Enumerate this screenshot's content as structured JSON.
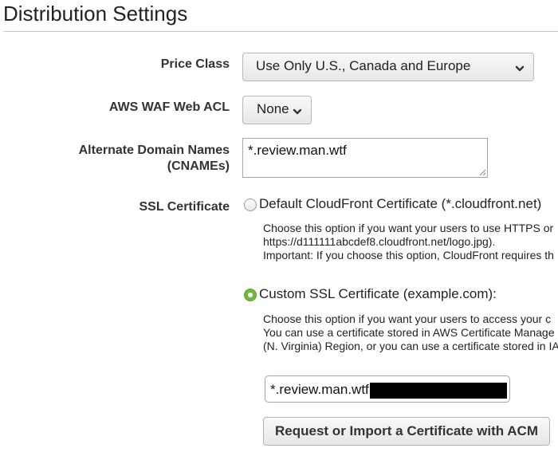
{
  "page": {
    "title": "Distribution Settings"
  },
  "price_class": {
    "label": "Price Class",
    "selected": "Use Only U.S., Canada and Europe"
  },
  "waf": {
    "label": "AWS WAF Web ACL",
    "selected": "None"
  },
  "cnames": {
    "label_line1": "Alternate Domain Names",
    "label_line2": "(CNAMEs)",
    "value": "*.review.man.wtf"
  },
  "ssl": {
    "label": "SSL Certificate",
    "default_option": {
      "label": "Default CloudFront Certificate (*.cloudfront.net)",
      "checked": false,
      "help_lines": [
        "Choose this option if you want your users to use HTTPS or",
        "https://d111111abcdef8.cloudfront.net/logo.jpg).",
        "Important: If you choose this option, CloudFront requires th"
      ]
    },
    "custom_option": {
      "label": "Custom SSL Certificate (example.com):",
      "checked": true,
      "help_lines": [
        "Choose this option if you want your users to access your c",
        "You can use a certificate stored in AWS Certificate Manage",
        "(N. Virginia) Region, or you can use a certificate stored in IA"
      ],
      "certificate_value": "*.review.man.wtf"
    },
    "acm_button_label": "Request or Import a Certificate with ACM"
  },
  "icons": {
    "dropdown": "chevron-down-icon",
    "resize": "resize-grip-icon"
  },
  "colors": {
    "radio_selected": "#6dbb3b",
    "title_rule": "#c9c9c9"
  }
}
